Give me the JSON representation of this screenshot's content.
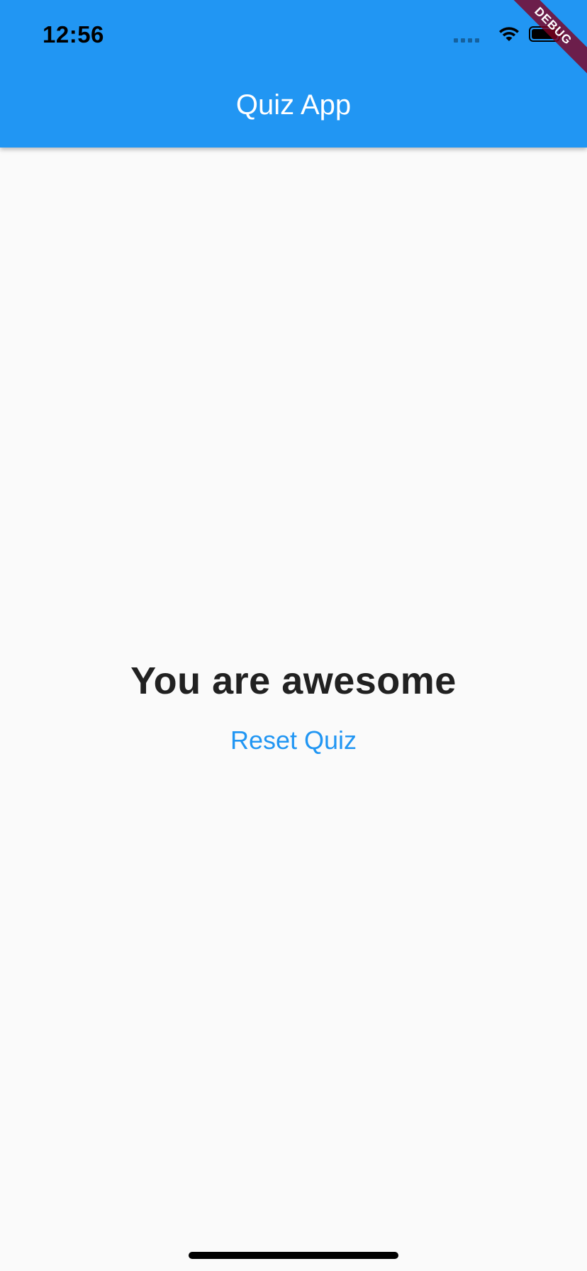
{
  "status_bar": {
    "time": "12:56",
    "icons": [
      "signal-icon",
      "wifi-icon",
      "battery-icon"
    ]
  },
  "app_bar": {
    "title": "Quiz App",
    "color": "#2196f3"
  },
  "debug_banner": {
    "label": "DEBUG"
  },
  "main": {
    "result_text": "You are awesome",
    "reset_label": "Reset Quiz"
  },
  "colors": {
    "primary": "#2196f3",
    "background": "#fafafa",
    "text": "#212121"
  }
}
